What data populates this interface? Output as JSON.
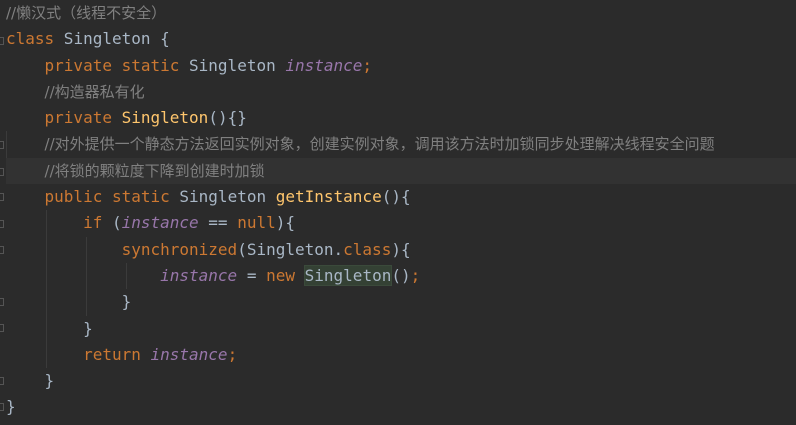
{
  "editor": {
    "lines": [
      {
        "comment": "//懒汉式（线程不安全）"
      },
      {
        "kw": "class",
        "name": " Singleton {"
      },
      {
        "indent": "    ",
        "kw": "private static",
        "type": " Singleton ",
        "field": "instance",
        "end": ";"
      },
      {
        "indent": "    ",
        "comment": "//构造器私有化"
      },
      {
        "indent": "    ",
        "kw": "private",
        "sp": " ",
        "method": "Singleton",
        "end": "(){}"
      },
      {
        "indent": "    ",
        "comment": "//对外提供一个静态方法返回实例对象，创建实例对象，调用该方法时加锁同步处理解决线程安全问题"
      },
      {
        "indent": "    ",
        "comment": "//将锁的颗粒度下降到创建时加锁"
      },
      {
        "indent": "    ",
        "kw": "public static",
        "type": " Singleton ",
        "method": "getInstance",
        "end": "(){"
      },
      {
        "indent": "        ",
        "kw": "if",
        "p1": " (",
        "field": "instance",
        "op": " == ",
        "kw2": "null",
        "end": "){"
      },
      {
        "indent": "            ",
        "kw": "synchronized",
        "p1": "(Singleton.",
        "kw2": "class",
        "end": "){"
      },
      {
        "indent": "                ",
        "field": "instance",
        "op": " = ",
        "kw2": "new",
        "sp": " ",
        "ref": "Singleton",
        "p2": "()",
        "semi": ";"
      },
      {
        "indent": "            ",
        "end": "}"
      },
      {
        "indent": "        ",
        "end": "}"
      },
      {
        "indent": "        ",
        "kw": "return",
        "sp": " ",
        "field": "instance",
        "semi": ";"
      },
      {
        "indent": "    ",
        "end": "}"
      },
      {
        "end": "}"
      }
    ]
  }
}
